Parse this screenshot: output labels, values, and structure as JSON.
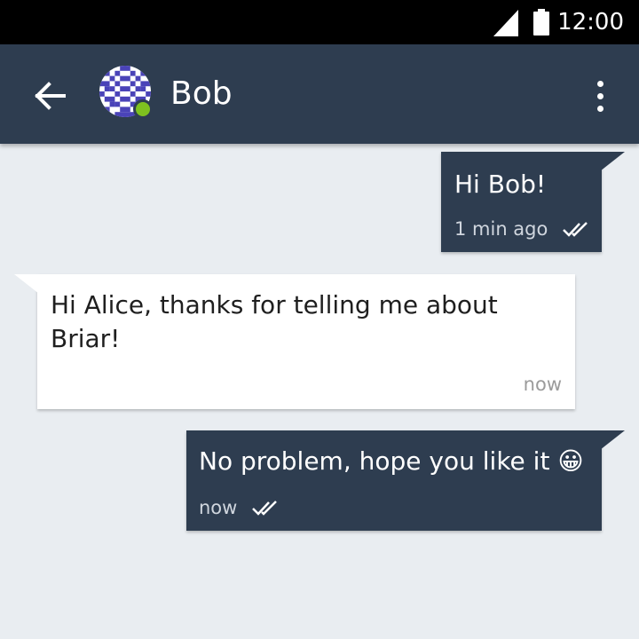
{
  "status_bar": {
    "time": "12:00"
  },
  "toolbar": {
    "contact_name": "Bob",
    "contact_online": true
  },
  "messages": [
    {
      "direction": "outgoing",
      "text": "Hi Bob!",
      "time": "1 min ago",
      "status_icon": "double-check-icon"
    },
    {
      "direction": "incoming",
      "text": "Hi Alice, thanks for telling me about Briar!",
      "time": "now"
    },
    {
      "direction": "outgoing",
      "text": "No problem, hope you like it 😀",
      "time": "now",
      "status_icon": "double-check-icon"
    }
  ],
  "colors": {
    "toolbar": "#2e3d50",
    "background": "#e9edf1",
    "outgoing_bubble": "#2e3d50",
    "incoming_bubble": "#ffffff",
    "online_indicator": "#7ec11f"
  }
}
